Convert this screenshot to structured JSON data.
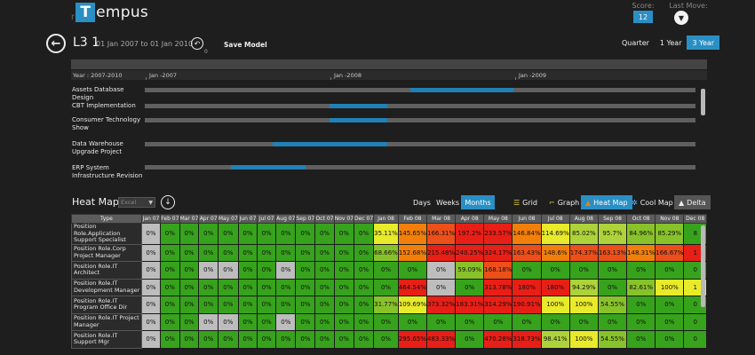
{
  "header": {
    "brand_prefix": "r",
    "brand_letter": "T",
    "brand_rest": "empus",
    "score_label": "Score:",
    "score_value": "12",
    "last_move_label": "Last Move:"
  },
  "project": {
    "title": "L3 1",
    "dates": "01 Jan 2007 to 01 Jan 2010",
    "history_sub": "0",
    "save_model_label": "Save Model"
  },
  "range_tabs": [
    "Quarter",
    "1 Year",
    "3 Year"
  ],
  "range_active": "3 Year",
  "timeline": {
    "year_label": "Year : 2007-2010",
    "year_ticks": [
      "Jan -2007",
      "Jan -2008",
      "Jan -2009"
    ],
    "rows": [
      {
        "label": "Assets Database Design",
        "start_frac": 0.483,
        "end_frac": 0.67
      },
      {
        "label": "CBT Implementation",
        "start_frac": 0.335,
        "end_frac": 0.44
      },
      {
        "label": "Consumer Technology Show",
        "start_frac": 0.335,
        "end_frac": 0.44
      },
      {
        "label": "Data Warehouse Upgrade Project",
        "start_frac": 0.232,
        "end_frac": 0.44
      },
      {
        "label": "ERP System Infrastructure Revision",
        "start_frac": 0.156,
        "end_frac": 0.292
      }
    ]
  },
  "heatmap": {
    "title": "Heat Map",
    "select_value": "Excel",
    "toolbar": {
      "days": "Days",
      "weeks": "Weeks",
      "months": "Months",
      "grid": "Grid",
      "graph": "Graph",
      "heat_map": "Heat Map",
      "cool_map": "Cool Map",
      "delta": "Delta"
    },
    "type_header": "Type",
    "months": [
      "Jan 07",
      "Feb 07",
      "Mar 07",
      "Apr 07",
      "May 07",
      "Jun 07",
      "Jul 07",
      "Aug 07",
      "Sep 07",
      "Oct 07",
      "Nov 07",
      "Dec 07",
      "Jan 08",
      "Feb 08",
      "Mar 08",
      "Apr 08",
      "May 08",
      "Jun 08",
      "Jul 08",
      "Aug 08",
      "Sep 08",
      "Oct 08",
      "Nov 08",
      "Dec 08"
    ],
    "rows": [
      {
        "type": "Position Role.Application Support Specialist",
        "values": [
          "0%",
          "0%",
          "0%",
          "0%",
          "0%",
          "0%",
          "0%",
          "0%",
          "0%",
          "0%",
          "0%",
          "0%",
          "35.11%",
          "145.65%",
          "166.31%",
          "197.2%",
          "233.57%",
          "146.84%",
          "114.69%",
          "85.02%",
          "95.7%",
          "84.96%",
          "85.29%",
          "8"
        ],
        "colors": [
          "gray",
          "green",
          "green",
          "green",
          "green",
          "green",
          "green",
          "green",
          "green",
          "green",
          "green",
          "green",
          "yellow",
          "orange",
          "orred",
          "red",
          "red",
          "orange",
          "yellow",
          "ygreen",
          "ygreen",
          "lgreen",
          "lgreen",
          "green"
        ]
      },
      {
        "type": "Position Role.Corp Project Manager",
        "values": [
          "0%",
          "0%",
          "0%",
          "0%",
          "0%",
          "0%",
          "0%",
          "0%",
          "0%",
          "0%",
          "0%",
          "0%",
          "68.66%",
          "152.68%",
          "215.48%",
          "240.25%",
          "324.17%",
          "163.43%",
          "148.6%",
          "174.37%",
          "163.13%",
          "148.31%",
          "166.67%",
          "1"
        ],
        "colors": [
          "gray",
          "green",
          "green",
          "green",
          "green",
          "green",
          "green",
          "green",
          "green",
          "green",
          "green",
          "green",
          "lgreen",
          "orange",
          "red",
          "red",
          "red",
          "orred",
          "orange",
          "orred",
          "orred",
          "orange",
          "orred",
          "red"
        ]
      },
      {
        "type": "Position Role.IT Architect",
        "values": [
          "0%",
          "0%",
          "0%",
          "0%",
          "0%",
          "0%",
          "0%",
          "0%",
          "0%",
          "0%",
          "0%",
          "0%",
          "0%",
          "0%",
          "0%",
          "59.09%",
          "168.18%",
          "0%",
          "0%",
          "0%",
          "0%",
          "0%",
          "0%",
          "0"
        ],
        "colors": [
          "gray",
          "green",
          "green",
          "gray",
          "gray",
          "green",
          "green",
          "gray",
          "green",
          "green",
          "green",
          "green",
          "green",
          "green",
          "gray",
          "lgreen",
          "orred",
          "green",
          "green",
          "green",
          "green",
          "green",
          "green",
          "green"
        ]
      },
      {
        "type": "Position Role.IT Development Manager",
        "values": [
          "0%",
          "0%",
          "0%",
          "0%",
          "0%",
          "0%",
          "0%",
          "0%",
          "0%",
          "0%",
          "0%",
          "0%",
          "0%",
          "464.54%",
          "0%",
          "0%",
          "313.78%",
          "180%",
          "180%",
          "94.29%",
          "0%",
          "82.61%",
          "100%",
          "1"
        ],
        "colors": [
          "gray",
          "green",
          "green",
          "green",
          "green",
          "green",
          "green",
          "green",
          "green",
          "green",
          "green",
          "green",
          "green",
          "red",
          "gray",
          "green",
          "red",
          "red",
          "red",
          "ygreen",
          "green",
          "lgreen",
          "yellow",
          "yellow"
        ]
      },
      {
        "type": "Position Role.IT Program Office Dir",
        "values": [
          "0%",
          "0%",
          "0%",
          "0%",
          "0%",
          "0%",
          "0%",
          "0%",
          "0%",
          "0%",
          "0%",
          "0%",
          "31.77%",
          "109.69%",
          "373.32%",
          "183.31%",
          "314.29%",
          "190.91%",
          "100%",
          "100%",
          "54.55%",
          "0%",
          "0%",
          "0"
        ],
        "colors": [
          "gray",
          "green",
          "green",
          "green",
          "green",
          "green",
          "green",
          "green",
          "green",
          "green",
          "green",
          "green",
          "lgreen",
          "yellow",
          "red",
          "red",
          "red",
          "red",
          "yellow",
          "yellow",
          "lgreen",
          "green",
          "green",
          "green"
        ]
      },
      {
        "type": "Position Role.IT Project Manager",
        "values": [
          "0%",
          "0%",
          "0%",
          "0%",
          "0%",
          "0%",
          "0%",
          "0%",
          "0%",
          "0%",
          "0%",
          "0%",
          "0%",
          "0%",
          "0%",
          "0%",
          "0%",
          "0%",
          "0%",
          "0%",
          "0%",
          "0%",
          "0%",
          "0"
        ],
        "colors": [
          "gray",
          "green",
          "green",
          "gray",
          "gray",
          "green",
          "green",
          "gray",
          "green",
          "green",
          "green",
          "green",
          "green",
          "green",
          "green",
          "green",
          "green",
          "green",
          "green",
          "green",
          "green",
          "green",
          "green",
          "green"
        ]
      },
      {
        "type": "Position Role.IT Support Mgr",
        "values": [
          "0%",
          "0%",
          "0%",
          "0%",
          "0%",
          "0%",
          "0%",
          "0%",
          "0%",
          "0%",
          "0%",
          "0%",
          "0%",
          "295.65%",
          "483.33%",
          "0%",
          "470.28%",
          "318.73%",
          "98.41%",
          "100%",
          "54.55%",
          "0%",
          "0%",
          "0"
        ],
        "colors": [
          "gray",
          "green",
          "green",
          "green",
          "green",
          "green",
          "green",
          "green",
          "green",
          "green",
          "green",
          "green",
          "green",
          "red",
          "red",
          "green",
          "red",
          "red",
          "ygreen",
          "yellow",
          "lgreen",
          "green",
          "green",
          "green"
        ]
      }
    ]
  }
}
